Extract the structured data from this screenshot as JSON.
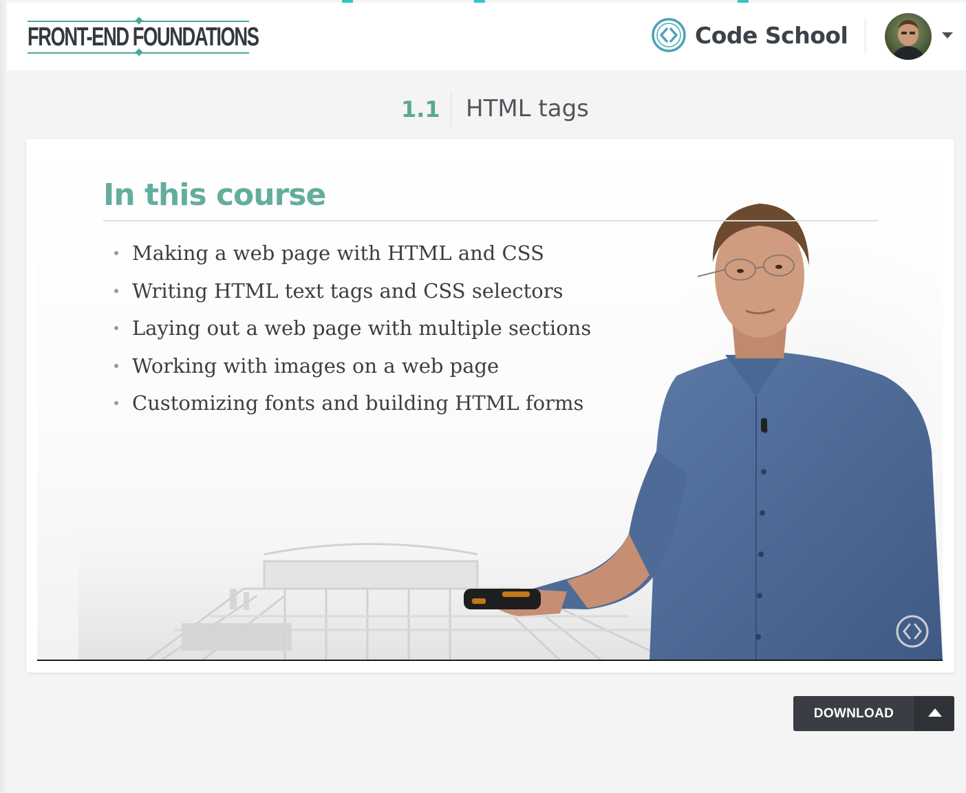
{
  "header": {
    "brand": "FRONT-END FOUNDATIONS",
    "site_name": "Code School"
  },
  "lesson": {
    "number": "1.1",
    "title": "HTML tags"
  },
  "slide": {
    "heading": "In this course",
    "items": [
      "Making a web page with HTML and CSS",
      "Writing HTML text tags and CSS selectors",
      "Laying out a web page with multiple sections",
      "Working with images on a web page",
      "Customizing fonts and building HTML forms"
    ]
  },
  "download": {
    "label": "DOWNLOAD"
  },
  "colors": {
    "accent": "#5ea695",
    "button": "#3a3e44",
    "cyan_accent": "#34c7c2"
  }
}
